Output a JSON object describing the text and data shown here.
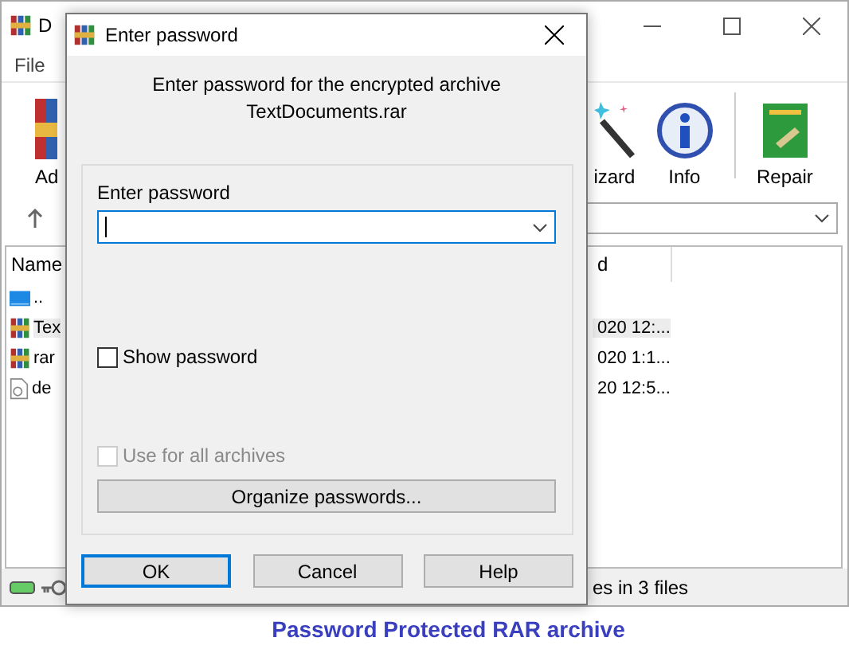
{
  "main_window": {
    "title": "D",
    "menu": [
      "File"
    ],
    "toolbar": [
      {
        "label": "Ad",
        "kind": "add"
      },
      {
        "label": "izard",
        "kind": "wizard"
      },
      {
        "label": "Info",
        "kind": "info"
      },
      {
        "label": "Repair",
        "kind": "repair"
      }
    ],
    "columns": [
      "Name",
      "d"
    ],
    "rows": [
      {
        "name": "..",
        "kind": "up",
        "selected": false
      },
      {
        "name": "Tex",
        "modified": "020 12:...",
        "kind": "archive",
        "selected": true
      },
      {
        "name": "rar",
        "modified": "020 1:1...",
        "kind": "archive",
        "selected": false
      },
      {
        "name": "de",
        "modified": "20 12:5...",
        "kind": "file",
        "selected": false
      }
    ],
    "status": "es in 3 files"
  },
  "dialog": {
    "title": "Enter password",
    "message": [
      "Enter password for the encrypted archive",
      "TextDocuments.rar"
    ],
    "password": {
      "label": "Enter password"
    },
    "show_password": {
      "label": "Show password",
      "checked": false,
      "disabled": false
    },
    "use_for_all": {
      "label": "Use for all archives",
      "checked": false,
      "disabled": true
    },
    "organize_button": "Organize passwords...",
    "buttons": [
      {
        "label": "OK",
        "default": true
      },
      {
        "label": "Cancel",
        "default": false
      },
      {
        "label": "Help",
        "default": false
      }
    ]
  },
  "caption": "Password Protected RAR archive"
}
